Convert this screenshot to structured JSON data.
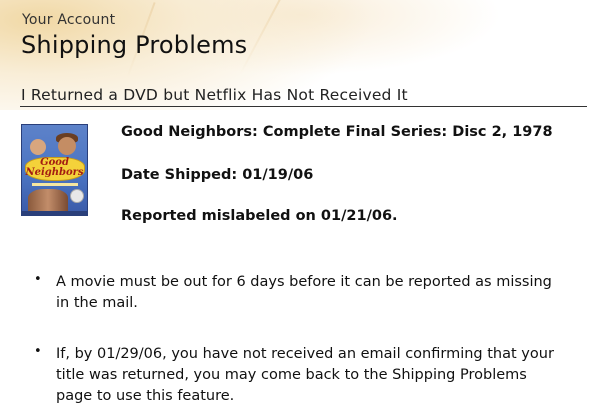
{
  "header": {
    "breadcrumb": "Your Account",
    "title": "Shipping Problems"
  },
  "section": {
    "heading": "I Returned a DVD but Netflix Has Not Received It"
  },
  "movie": {
    "cover_title_line1": "Good",
    "cover_title_line2": "Neighbors",
    "title": "Good Neighbors: Complete Final Series: Disc 2, 1978",
    "date_shipped": "Date Shipped: 01/19/06",
    "report_status": "Reported mislabeled on 01/21/06."
  },
  "notes": [
    {
      "bullet": "•",
      "text": "A movie must be out for 6 days before it can be reported as missing in the mail."
    },
    {
      "bullet": "•",
      "text": "If, by 01/29/06, you have not received an email confirming that your title was returned, you may come back to the Shipping Problems page to use this feature."
    }
  ]
}
